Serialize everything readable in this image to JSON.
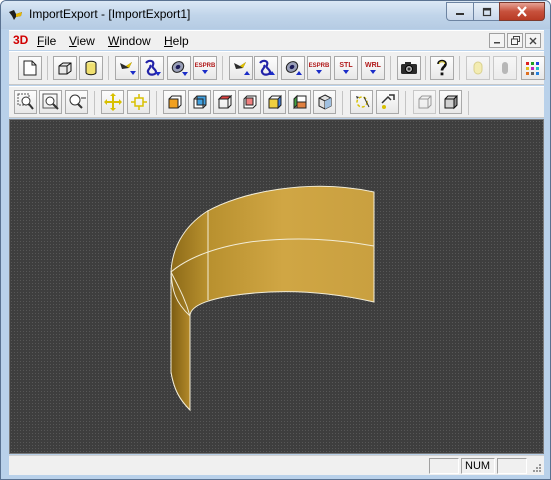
{
  "window": {
    "title": "ImportExport - [ImportExport1]"
  },
  "menu": {
    "logo": "3D",
    "items": [
      {
        "label": "File",
        "mnemonic": "F",
        "rest": "ile"
      },
      {
        "label": "View",
        "mnemonic": "V",
        "rest": "iew"
      },
      {
        "label": "Window",
        "mnemonic": "W",
        "rest": "indow"
      },
      {
        "label": "Help",
        "mnemonic": "H",
        "rest": "elp"
      }
    ]
  },
  "toolbar1": {
    "step_label_1": "ESPRB",
    "step_label_2": "ESPRB",
    "stl_label": "STL",
    "wrl_label": "WRL"
  },
  "status": {
    "num": "NUM"
  },
  "colors": {
    "viewport_bg": "#3e3e3e",
    "surface_gold": "#c9a040",
    "surface_edge": "#f2ecd6",
    "close_red": "#c7513c"
  }
}
